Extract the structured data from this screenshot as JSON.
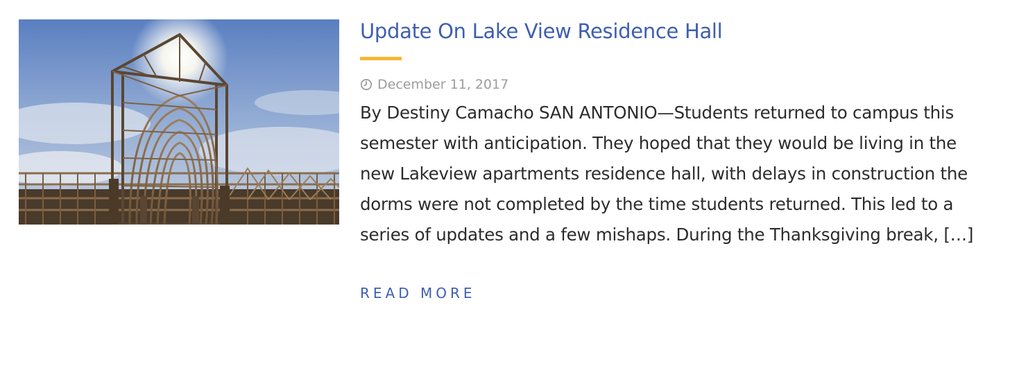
{
  "post": {
    "image": {
      "alt": "Lake View Residence Hall construction framing",
      "subject": "wooden-frame-construction-photo"
    },
    "title": "Update On Lake View Residence Hall",
    "date": "December 11, 2017",
    "excerpt": "By Destiny Camacho SAN ANTONIO—Students returned to campus this semester with anticipation. They hoped that they would be living in the new Lakeview apartments residence hall, with delays in construction the dorms were not completed by the time students returned. This led to a series of updates and a few mishaps. During the Thanksgiving break,",
    "more_text": "[…]",
    "read_more": "READ MORE"
  },
  "icons": {
    "date_icon": "clock-icon"
  },
  "colors": {
    "title": "#3d5fb0",
    "accent_rule": "#f5b733",
    "meta_text": "#9d9d9d",
    "body_text": "#2c2c2c",
    "read_more": "#3d5fb0"
  }
}
